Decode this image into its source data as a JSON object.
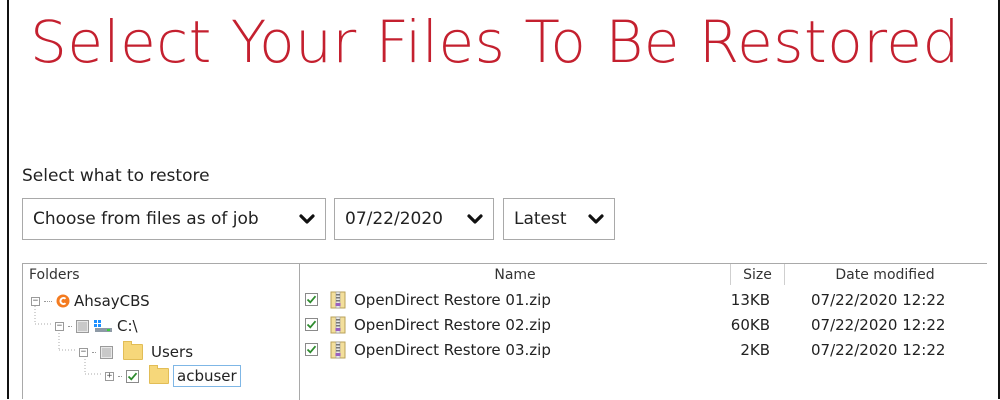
{
  "page": {
    "title": "Select Your Files To Be Restored",
    "subtitle": "Select what to restore"
  },
  "filters": {
    "job_selector": "Choose from files as of job",
    "date_selector": "07/22/2020",
    "version_selector": "Latest"
  },
  "folders_panel": {
    "header": "Folders",
    "tree": [
      {
        "label": "AhsayCBS",
        "icon": "ahsay-logo-icon",
        "expander": "minus",
        "checkbox": "none"
      },
      {
        "label": "C:\\",
        "icon": "drive-icon",
        "expander": "minus",
        "checkbox": "partial"
      },
      {
        "label": "Users",
        "icon": "folder-icon",
        "expander": "minus",
        "checkbox": "partial"
      },
      {
        "label": "acbuser",
        "icon": "folder-icon",
        "expander": "plus",
        "checkbox": "checked",
        "selected": true
      }
    ]
  },
  "files_panel": {
    "columns": {
      "name": "Name",
      "size": "Size",
      "date_modified": "Date modified"
    },
    "rows": [
      {
        "name": "OpenDirect Restore 01.zip",
        "size": "13KB",
        "date": "07/22/2020 12:22",
        "checked": true
      },
      {
        "name": "OpenDirect Restore 02.zip",
        "size": "60KB",
        "date": "07/22/2020 12:22",
        "checked": true
      },
      {
        "name": "OpenDirect Restore 03.zip",
        "size": "2KB",
        "date": "07/22/2020 12:22",
        "checked": true
      }
    ]
  },
  "colors": {
    "title": "#c4202f",
    "checkmark": "#2e8b2e",
    "ahsay_logo": "#f47b20",
    "folder": "#f6d77a",
    "selection_border": "#7fb7e6"
  }
}
